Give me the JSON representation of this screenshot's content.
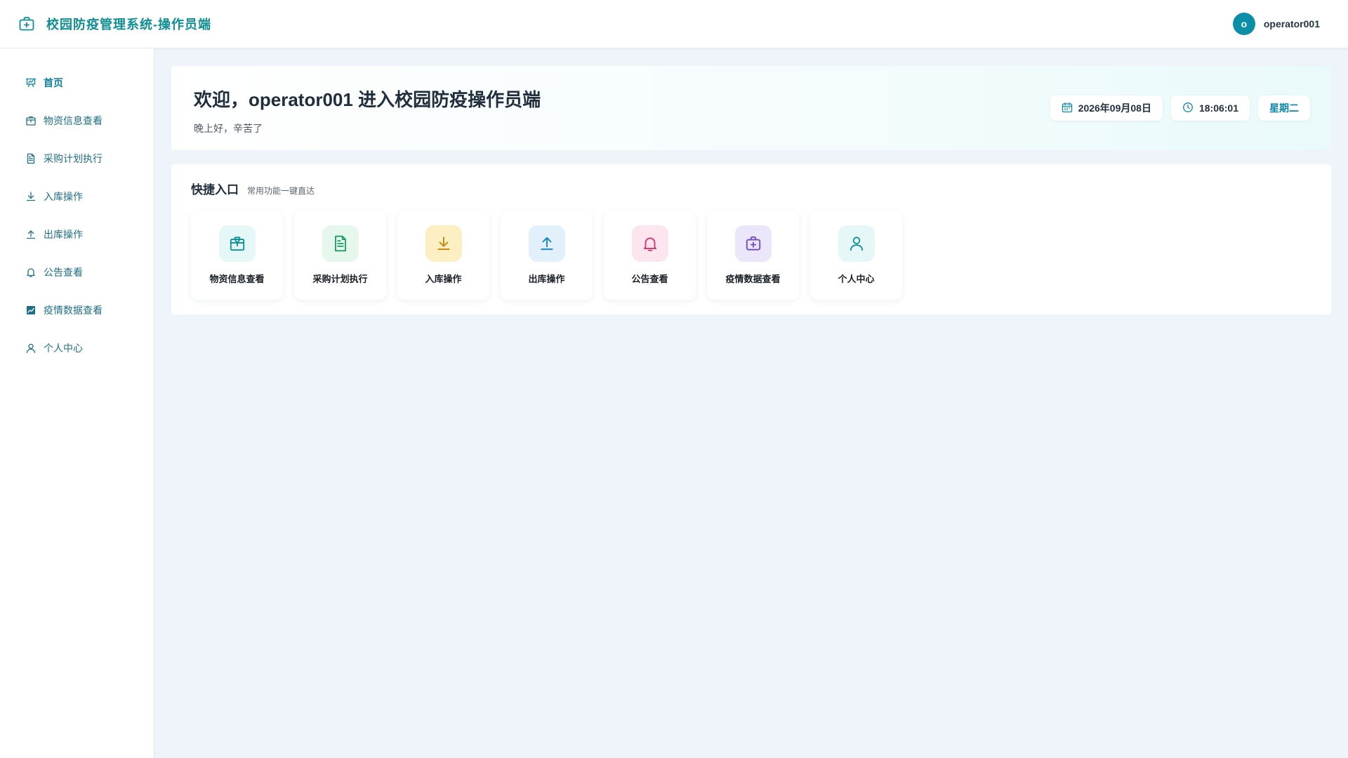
{
  "header": {
    "title": "校园防疫管理系统-操作员端",
    "avatar_letter": "o",
    "username": "operator001"
  },
  "sidebar": {
    "items": [
      {
        "label": "首页",
        "icon": "presentation-chart-icon",
        "active": true
      },
      {
        "label": "物资信息查看",
        "icon": "package-icon"
      },
      {
        "label": "采购计划执行",
        "icon": "document-icon"
      },
      {
        "label": "入库操作",
        "icon": "download-arrow-icon"
      },
      {
        "label": "出库操作",
        "icon": "upload-arrow-icon"
      },
      {
        "label": "公告查看",
        "icon": "bell-icon"
      },
      {
        "label": "疫情数据查看",
        "icon": "chart-icon"
      },
      {
        "label": "个人中心",
        "icon": "user-icon"
      }
    ]
  },
  "welcome": {
    "title": "欢迎，operator001 进入校园防疫操作员端",
    "subtitle": "晚上好，辛苦了",
    "date": "2026年09月08日",
    "time": "18:06:01",
    "weekday": "星期二"
  },
  "quick": {
    "title": "快捷入口",
    "subtitle": "常用功能一键直达",
    "cards": [
      {
        "label": "物资信息查看",
        "icon": "package-icon",
        "bg": "#e6f7f8",
        "fg": "#0e8f94"
      },
      {
        "label": "采购计划执行",
        "icon": "document-icon",
        "bg": "#e6f7ee",
        "fg": "#1e9e68"
      },
      {
        "label": "入库操作",
        "icon": "download-arrow-icon",
        "bg": "#fdefc4",
        "fg": "#c98a10"
      },
      {
        "label": "出库操作",
        "icon": "upload-arrow-icon",
        "bg": "#e2f0fb",
        "fg": "#1f86c8"
      },
      {
        "label": "公告查看",
        "icon": "bell-icon",
        "bg": "#fde5ef",
        "fg": "#d6336c"
      },
      {
        "label": "疫情数据查看",
        "icon": "medical-kit-icon",
        "bg": "#ece6fb",
        "fg": "#7048c8"
      },
      {
        "label": "个人中心",
        "icon": "user-icon",
        "bg": "#e6f7f8",
        "fg": "#0e8f94"
      }
    ]
  },
  "colors": {
    "accent": "#0e8f94",
    "nav_text": "#1f6f86",
    "page_bg": "#eef4fa"
  }
}
